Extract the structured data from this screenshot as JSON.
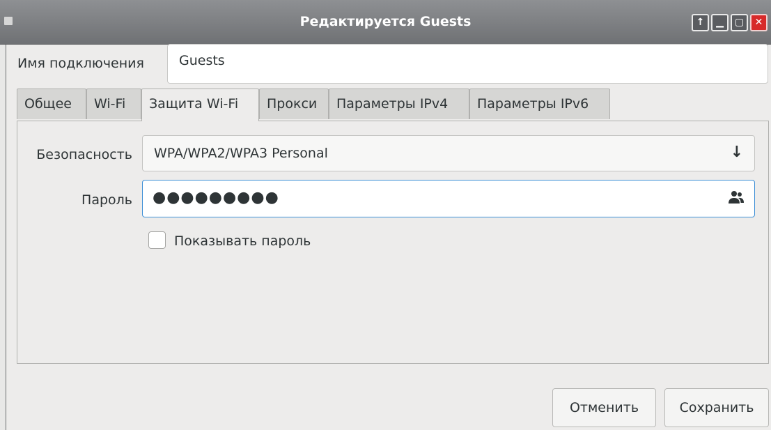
{
  "window": {
    "title": "Редактируется Guests",
    "controls": {
      "up": "↑",
      "minimize": "▁",
      "maximize": "▢",
      "close": "✕"
    }
  },
  "connection": {
    "label": "Имя подключения",
    "value": "Guests"
  },
  "tabs": [
    {
      "label": "Общее",
      "active": false
    },
    {
      "label": "Wi-Fi",
      "active": false
    },
    {
      "label": "Защита Wi-Fi",
      "active": true
    },
    {
      "label": "Прокси",
      "active": false
    },
    {
      "label": "Параметры IPv4",
      "active": false
    },
    {
      "label": "Параметры IPv6",
      "active": false
    }
  ],
  "security": {
    "label": "Безопасность",
    "selected": "WPA/WPA2/WPA3 Personal",
    "arrow_icon": "arrow-down-icon"
  },
  "password": {
    "label": "Пароль",
    "masked_value": "●●●●●●●●●",
    "icon": "users-icon"
  },
  "show_password": {
    "label": "Показывать пароль",
    "checked": false
  },
  "buttons": {
    "cancel": "Отменить",
    "save": "Сохранить"
  },
  "colors": {
    "titlebar": "#7f8184",
    "focus": "#3d8fd6",
    "close": "#d72a2a"
  }
}
